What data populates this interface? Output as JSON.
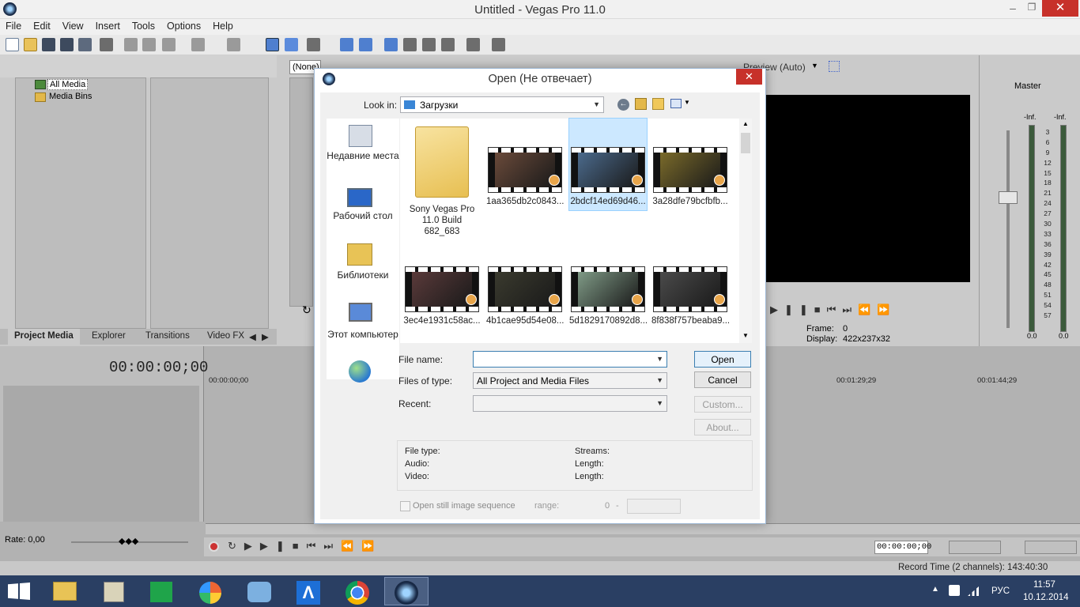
{
  "window": {
    "title": "Untitled - Vegas Pro 11.0"
  },
  "menu": [
    "File",
    "Edit",
    "View",
    "Insert",
    "Tools",
    "Options",
    "Help"
  ],
  "media_tree": {
    "items": [
      "All Media",
      "Media Bins"
    ]
  },
  "left_tabs": [
    "Project Media",
    "Explorer",
    "Transitions",
    "Video FX"
  ],
  "preview": {
    "combo": "(None)",
    "mode": "Preview (Auto)",
    "frame_label": "Frame:",
    "frame_value": "0",
    "display_label": "Display:",
    "display_value": "422x237x32"
  },
  "master": {
    "label": "Master",
    "meter_top_left": "-Inf.",
    "meter_top_right": "-Inf.",
    "scale": [
      "3",
      "6",
      "9",
      "12",
      "15",
      "18",
      "21",
      "24",
      "27",
      "30",
      "33",
      "36",
      "39",
      "42",
      "45",
      "48",
      "51",
      "54",
      "57"
    ],
    "bottom_left": "0.0",
    "bottom_right": "0.0"
  },
  "timeline": {
    "timecode": "00:00:00;00",
    "ruler": [
      "00:00:00;00",
      "00:01:29;29",
      "00:01:44;29"
    ],
    "rate": "Rate: 0,00",
    "cursor_time": "00:00:00;00",
    "record_time": "Record Time (2 channels): 143:40:30"
  },
  "dialog": {
    "title": "Open (Не отвечает)",
    "look_in_label": "Look in:",
    "look_in_value": "Загрузки",
    "places": [
      "Недавние места",
      "Рабочий стол",
      "Библиотеки",
      "Этот компьютер"
    ],
    "files": [
      {
        "name": "Sony Vegas Pro 11.0 Build 682_683",
        "kind": "folder"
      },
      {
        "name": "1aa365db2c0843...",
        "kind": "video",
        "tint": "#6a4a3a"
      },
      {
        "name": "2bdcf14ed69d46...",
        "kind": "video",
        "tint": "#4b6a8c"
      },
      {
        "name": "3a28dfe79bcfbfb...",
        "kind": "video",
        "tint": "#7a6a2a"
      },
      {
        "name": "3ec4e1931c58ac...",
        "kind": "video",
        "tint": "#5a3a3a"
      },
      {
        "name": "4b1cae95d54e08...",
        "kind": "video",
        "tint": "#3a3a2e"
      },
      {
        "name": "5d1829170892d8...",
        "kind": "video",
        "tint": "#7f9a86"
      },
      {
        "name": "8f838f757beaba9...",
        "kind": "video",
        "tint": "#4a4a4a"
      }
    ],
    "file_name_label": "File name:",
    "file_name_value": "",
    "files_of_type_label": "Files of type:",
    "files_of_type_value": "All Project and Media Files",
    "recent_label": "Recent:",
    "open_button": "Open",
    "cancel_button": "Cancel",
    "custom_button": "Custom...",
    "about_button": "About...",
    "info": {
      "file_type": "File type:",
      "audio": "Audio:",
      "video": "Video:",
      "streams": "Streams:",
      "length1": "Length:",
      "length2": "Length:"
    },
    "still_seq": "Open still image sequence",
    "range_label": "range:",
    "range_from": "0",
    "range_dash": "-"
  },
  "tray": {
    "lang": "РУС",
    "time": "11:57",
    "date": "10.12.2014"
  },
  "colors": {
    "taskbar": "#2a3f63",
    "dialog_close": "#c7312a",
    "selection": "#cce8ff"
  }
}
